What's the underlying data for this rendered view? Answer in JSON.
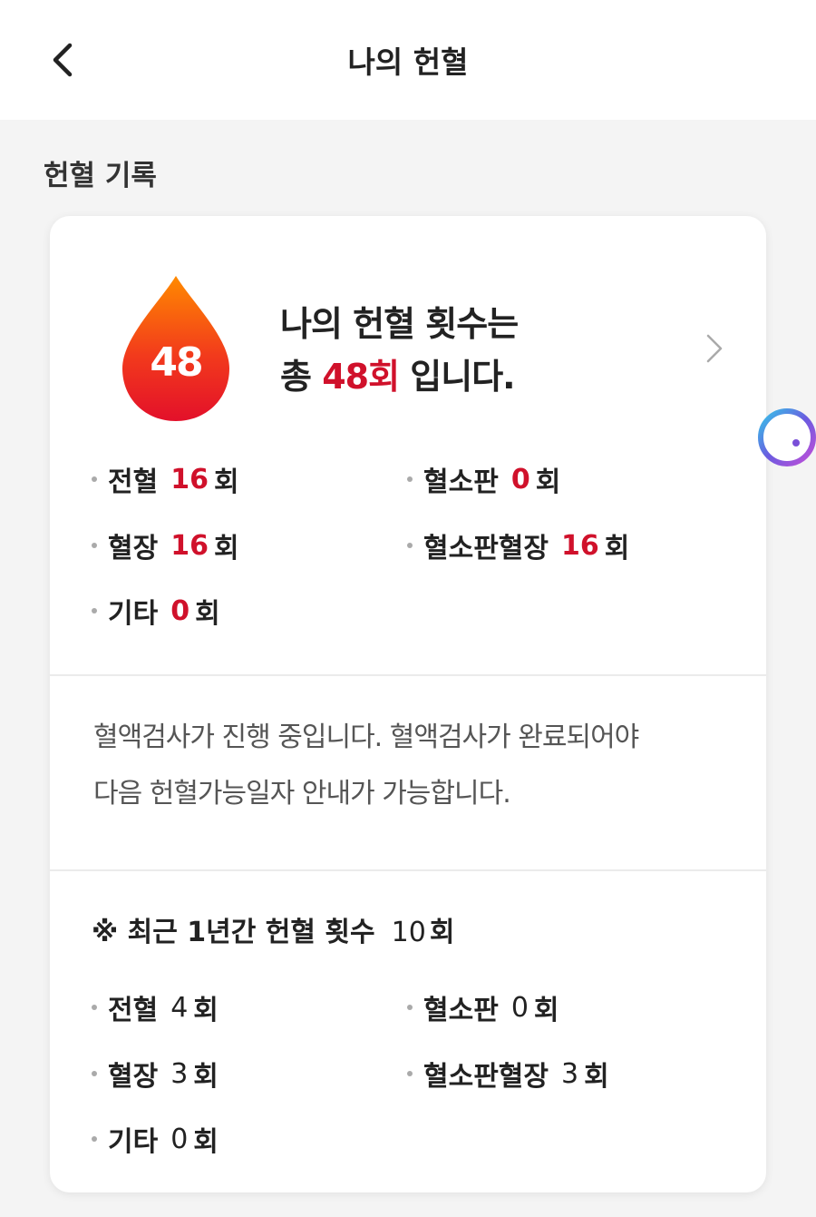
{
  "header": {
    "title": "나의 헌혈",
    "back_icon": "chevron-left-icon"
  },
  "section": {
    "title": "헌혈 기록"
  },
  "summary": {
    "total_count": "48",
    "headline_line1": "나의 헌혈 횟수는",
    "headline_prefix": "총 ",
    "headline_total": "48회",
    "headline_suffix": " 입니다.",
    "chevron_icon": "chevron-right-icon",
    "drop_colors": [
      "#ff7a00",
      "#e8102a"
    ],
    "accent_color": "#d0112b",
    "stats": [
      {
        "label": "전혈",
        "value": "16",
        "unit": "회"
      },
      {
        "label": "혈소판",
        "value": "0",
        "unit": "회"
      },
      {
        "label": "혈장",
        "value": "16",
        "unit": "회"
      },
      {
        "label": "혈소판혈장",
        "value": "16",
        "unit": "회"
      },
      {
        "label": "기타",
        "value": "0",
        "unit": "회"
      }
    ]
  },
  "notice": {
    "line1": "혈액검사가 진행 중입니다. 혈액검사가 완료되어야",
    "line2": "다음 헌혈가능일자 안내가 가능합니다."
  },
  "recent": {
    "title": "※ 최근 1년간 헌혈 횟수",
    "count": "10",
    "unit": "회",
    "stats": [
      {
        "label": "전혈",
        "value": "4",
        "unit": "회"
      },
      {
        "label": "혈소판",
        "value": "0",
        "unit": "회"
      },
      {
        "label": "혈장",
        "value": "3",
        "unit": "회"
      },
      {
        "label": "혈소판혈장",
        "value": "3",
        "unit": "회"
      },
      {
        "label": "기타",
        "value": "0",
        "unit": "회"
      }
    ]
  },
  "floating_button": {
    "icon": "assistant-ring-icon"
  }
}
